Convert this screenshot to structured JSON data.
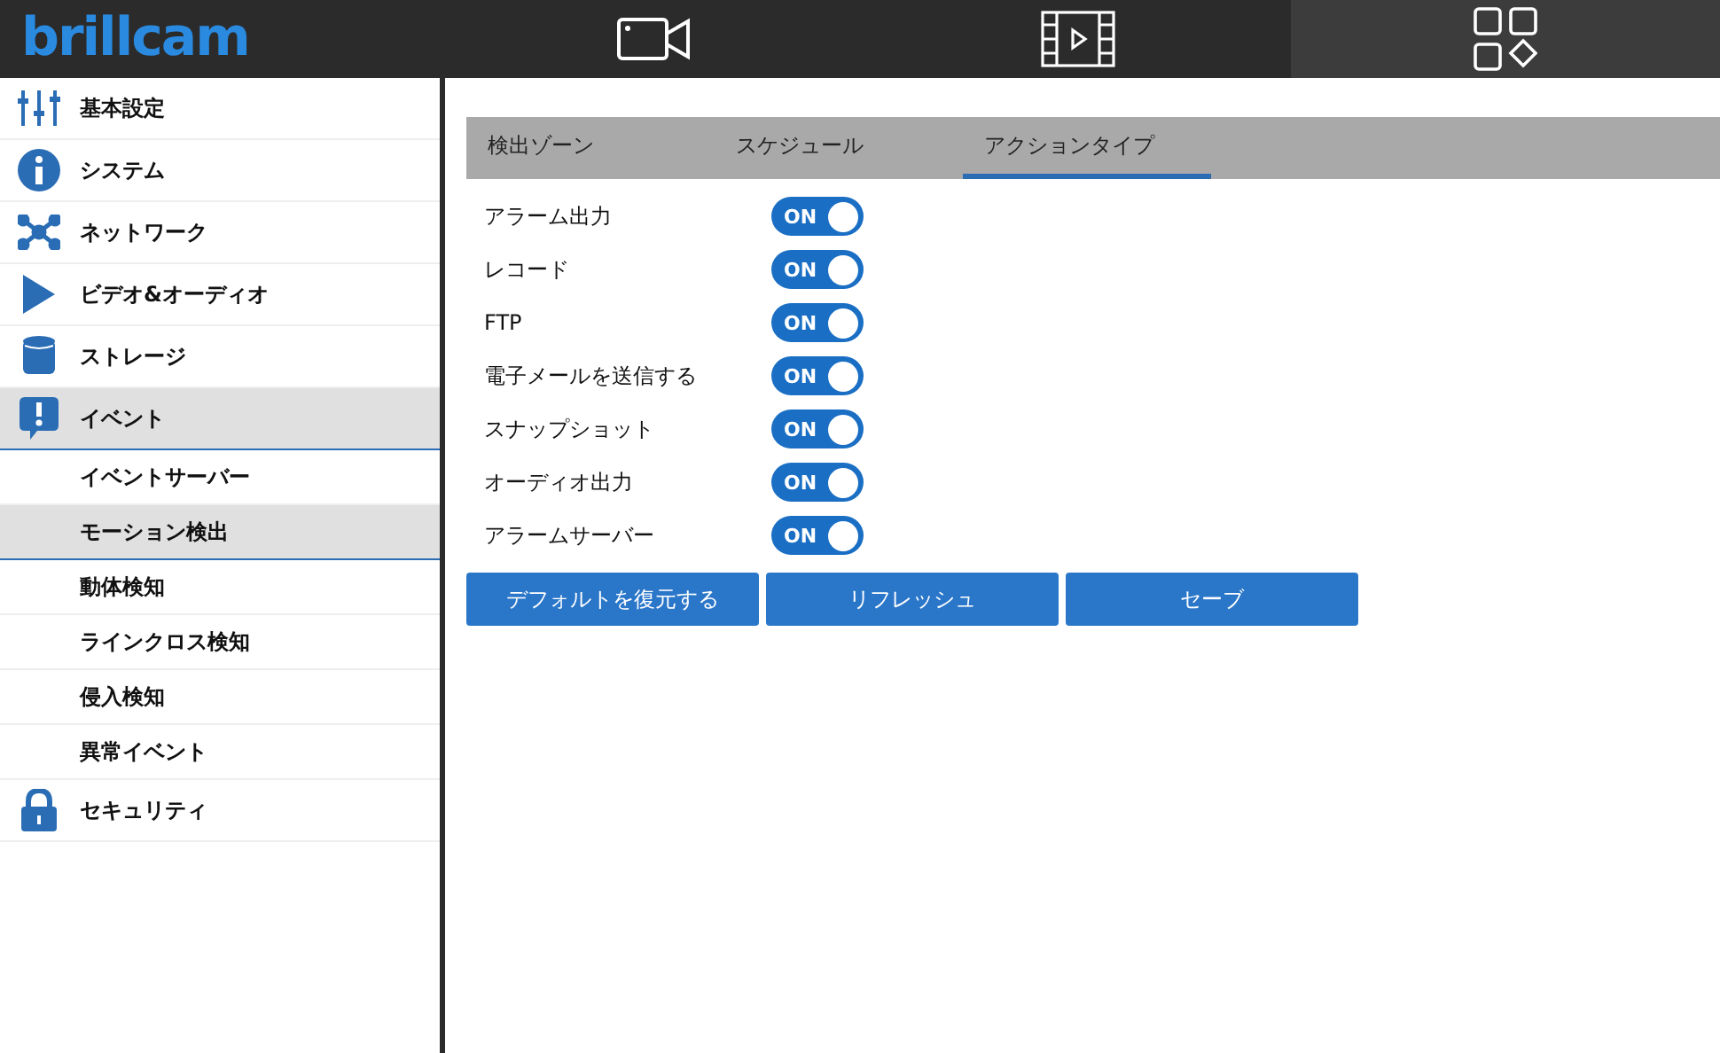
{
  "header": {
    "logo": "brillcam",
    "nav": [
      {
        "selected": false
      },
      {
        "selected": false
      },
      {
        "selected": true
      }
    ]
  },
  "sidebar": {
    "items": [
      {
        "label": "基本設定",
        "selected": false
      },
      {
        "label": "システム",
        "selected": false
      },
      {
        "label": "ネットワーク",
        "selected": false
      },
      {
        "label": "ビデオ&オーディオ",
        "selected": false
      },
      {
        "label": "ストレージ",
        "selected": false
      },
      {
        "label": "イベント",
        "selected": true,
        "expanded": true,
        "children": [
          {
            "label": "イベントサーバー",
            "selected": false
          },
          {
            "label": "モーション検出",
            "selected": true
          },
          {
            "label": "動体検知",
            "selected": false
          },
          {
            "label": "ラインクロス検知",
            "selected": false
          },
          {
            "label": "侵入検知",
            "selected": false
          },
          {
            "label": "異常イベント",
            "selected": false
          }
        ]
      },
      {
        "label": "セキュリティ",
        "selected": false
      }
    ]
  },
  "tabs": [
    {
      "label": "検出ゾーン",
      "selected": false
    },
    {
      "label": "スケジュール",
      "selected": false
    },
    {
      "label": "アクションタイプ",
      "selected": true
    }
  ],
  "actions": [
    {
      "label": "アラーム出力",
      "on": true,
      "switch_text": "ON"
    },
    {
      "label": "レコード",
      "on": true,
      "switch_text": "ON"
    },
    {
      "label": "FTP",
      "on": true,
      "switch_text": "ON"
    },
    {
      "label": "電子メールを送信する",
      "on": true,
      "switch_text": "ON"
    },
    {
      "label": "スナップショット",
      "on": true,
      "switch_text": "ON"
    },
    {
      "label": "オーディオ出力",
      "on": true,
      "switch_text": "ON"
    },
    {
      "label": "アラームサーバー",
      "on": true,
      "switch_text": "ON"
    }
  ],
  "buttons": [
    "デフォルトを復元する",
    "リフレッシュ",
    "セーブ"
  ]
}
